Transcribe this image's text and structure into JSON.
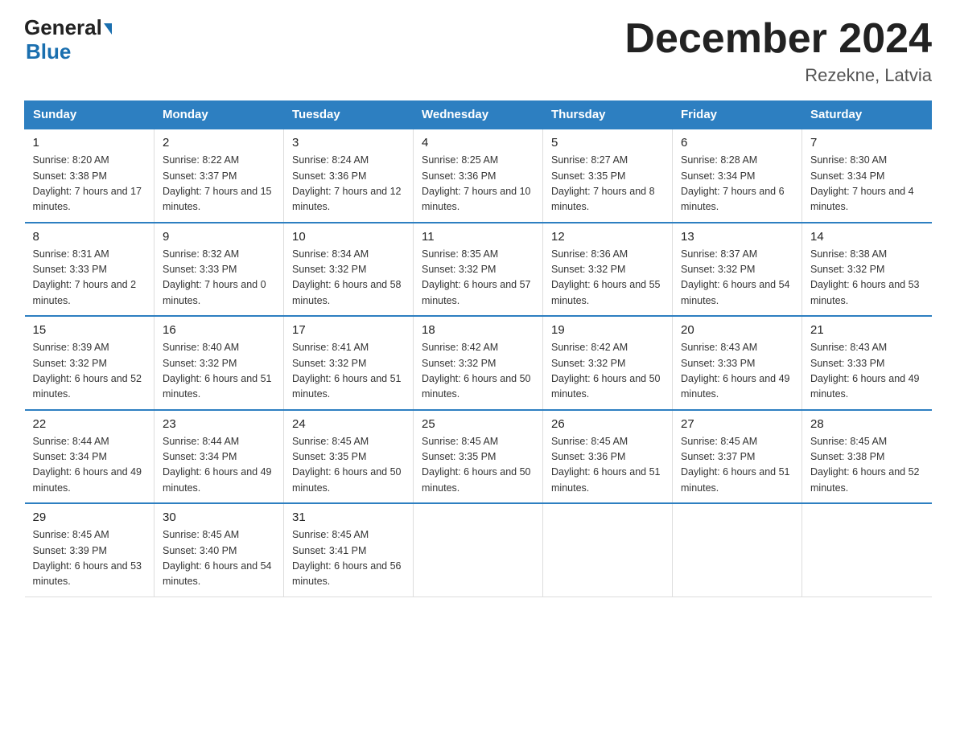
{
  "header": {
    "logo_line1": "General",
    "logo_line2": "Blue",
    "month_title": "December 2024",
    "subtitle": "Rezekne, Latvia"
  },
  "days_of_week": [
    "Sunday",
    "Monday",
    "Tuesday",
    "Wednesday",
    "Thursday",
    "Friday",
    "Saturday"
  ],
  "weeks": [
    [
      {
        "day": "1",
        "sunrise": "8:20 AM",
        "sunset": "3:38 PM",
        "daylight": "7 hours and 17 minutes."
      },
      {
        "day": "2",
        "sunrise": "8:22 AM",
        "sunset": "3:37 PM",
        "daylight": "7 hours and 15 minutes."
      },
      {
        "day": "3",
        "sunrise": "8:24 AM",
        "sunset": "3:36 PM",
        "daylight": "7 hours and 12 minutes."
      },
      {
        "day": "4",
        "sunrise": "8:25 AM",
        "sunset": "3:36 PM",
        "daylight": "7 hours and 10 minutes."
      },
      {
        "day": "5",
        "sunrise": "8:27 AM",
        "sunset": "3:35 PM",
        "daylight": "7 hours and 8 minutes."
      },
      {
        "day": "6",
        "sunrise": "8:28 AM",
        "sunset": "3:34 PM",
        "daylight": "7 hours and 6 minutes."
      },
      {
        "day": "7",
        "sunrise": "8:30 AM",
        "sunset": "3:34 PM",
        "daylight": "7 hours and 4 minutes."
      }
    ],
    [
      {
        "day": "8",
        "sunrise": "8:31 AM",
        "sunset": "3:33 PM",
        "daylight": "7 hours and 2 minutes."
      },
      {
        "day": "9",
        "sunrise": "8:32 AM",
        "sunset": "3:33 PM",
        "daylight": "7 hours and 0 minutes."
      },
      {
        "day": "10",
        "sunrise": "8:34 AM",
        "sunset": "3:32 PM",
        "daylight": "6 hours and 58 minutes."
      },
      {
        "day": "11",
        "sunrise": "8:35 AM",
        "sunset": "3:32 PM",
        "daylight": "6 hours and 57 minutes."
      },
      {
        "day": "12",
        "sunrise": "8:36 AM",
        "sunset": "3:32 PM",
        "daylight": "6 hours and 55 minutes."
      },
      {
        "day": "13",
        "sunrise": "8:37 AM",
        "sunset": "3:32 PM",
        "daylight": "6 hours and 54 minutes."
      },
      {
        "day": "14",
        "sunrise": "8:38 AM",
        "sunset": "3:32 PM",
        "daylight": "6 hours and 53 minutes."
      }
    ],
    [
      {
        "day": "15",
        "sunrise": "8:39 AM",
        "sunset": "3:32 PM",
        "daylight": "6 hours and 52 minutes."
      },
      {
        "day": "16",
        "sunrise": "8:40 AM",
        "sunset": "3:32 PM",
        "daylight": "6 hours and 51 minutes."
      },
      {
        "day": "17",
        "sunrise": "8:41 AM",
        "sunset": "3:32 PM",
        "daylight": "6 hours and 51 minutes."
      },
      {
        "day": "18",
        "sunrise": "8:42 AM",
        "sunset": "3:32 PM",
        "daylight": "6 hours and 50 minutes."
      },
      {
        "day": "19",
        "sunrise": "8:42 AM",
        "sunset": "3:32 PM",
        "daylight": "6 hours and 50 minutes."
      },
      {
        "day": "20",
        "sunrise": "8:43 AM",
        "sunset": "3:33 PM",
        "daylight": "6 hours and 49 minutes."
      },
      {
        "day": "21",
        "sunrise": "8:43 AM",
        "sunset": "3:33 PM",
        "daylight": "6 hours and 49 minutes."
      }
    ],
    [
      {
        "day": "22",
        "sunrise": "8:44 AM",
        "sunset": "3:34 PM",
        "daylight": "6 hours and 49 minutes."
      },
      {
        "day": "23",
        "sunrise": "8:44 AM",
        "sunset": "3:34 PM",
        "daylight": "6 hours and 49 minutes."
      },
      {
        "day": "24",
        "sunrise": "8:45 AM",
        "sunset": "3:35 PM",
        "daylight": "6 hours and 50 minutes."
      },
      {
        "day": "25",
        "sunrise": "8:45 AM",
        "sunset": "3:35 PM",
        "daylight": "6 hours and 50 minutes."
      },
      {
        "day": "26",
        "sunrise": "8:45 AM",
        "sunset": "3:36 PM",
        "daylight": "6 hours and 51 minutes."
      },
      {
        "day": "27",
        "sunrise": "8:45 AM",
        "sunset": "3:37 PM",
        "daylight": "6 hours and 51 minutes."
      },
      {
        "day": "28",
        "sunrise": "8:45 AM",
        "sunset": "3:38 PM",
        "daylight": "6 hours and 52 minutes."
      }
    ],
    [
      {
        "day": "29",
        "sunrise": "8:45 AM",
        "sunset": "3:39 PM",
        "daylight": "6 hours and 53 minutes."
      },
      {
        "day": "30",
        "sunrise": "8:45 AM",
        "sunset": "3:40 PM",
        "daylight": "6 hours and 54 minutes."
      },
      {
        "day": "31",
        "sunrise": "8:45 AM",
        "sunset": "3:41 PM",
        "daylight": "6 hours and 56 minutes."
      },
      null,
      null,
      null,
      null
    ]
  ]
}
